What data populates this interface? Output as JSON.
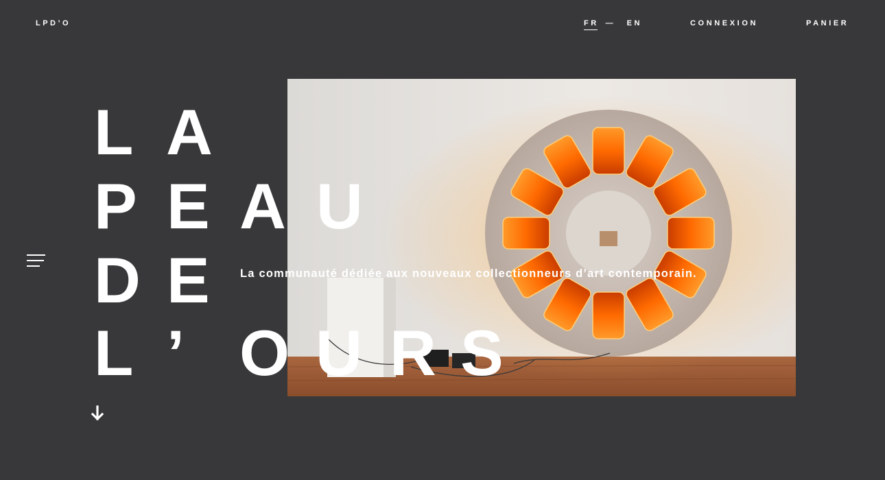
{
  "header": {
    "logo": "LPD’O",
    "lang": {
      "fr": "FR",
      "separator": "—",
      "en": "EN",
      "active": "FR"
    },
    "login_label": "CONNEXION",
    "cart_label": "PANIER"
  },
  "menu": {
    "icon": "menu-icon"
  },
  "hero": {
    "title_lines": [
      [
        "L",
        "A"
      ],
      [
        "P",
        "E",
        "A",
        "U"
      ],
      [
        "D",
        "E"
      ],
      [
        "L",
        "’",
        "O",
        "U",
        "R",
        "S"
      ]
    ],
    "tagline": "La communauté dédiée aux nouveaux collectionneurs d’art contemporain.",
    "image": "artwork-photo",
    "scroll_icon": "arrow-down-icon"
  },
  "colors": {
    "background": "#38383a",
    "text": "#ffffff"
  }
}
